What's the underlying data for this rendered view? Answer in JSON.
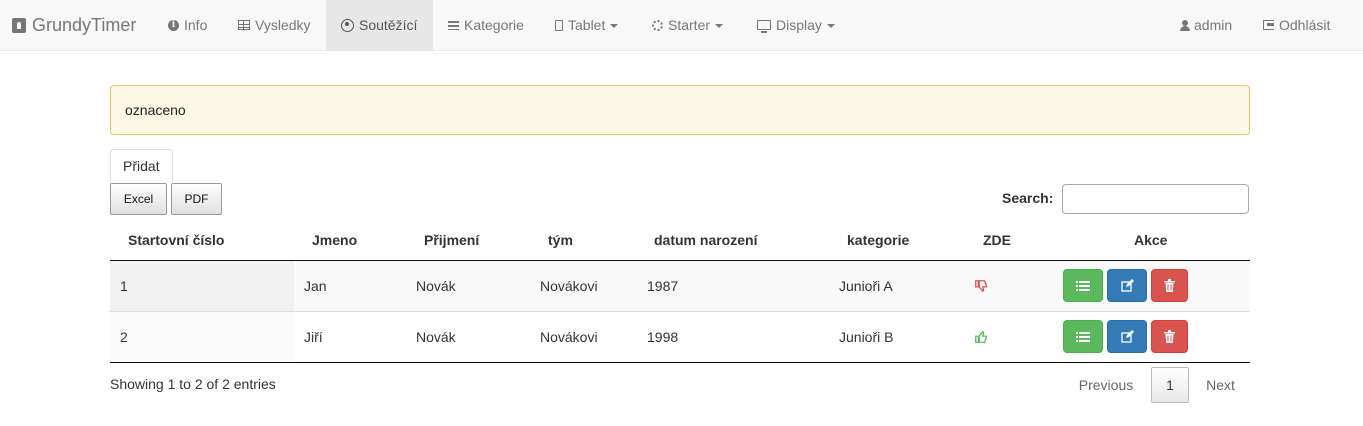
{
  "navbar": {
    "brand": "GrundyTimer",
    "items": [
      {
        "label": "Info",
        "icon": "info-circle-icon"
      },
      {
        "label": "Vysledky",
        "icon": "table-icon"
      },
      {
        "label": "Soutěžící",
        "icon": "user-circle-icon",
        "active": true
      },
      {
        "label": "Kategorie",
        "icon": "list-icon"
      },
      {
        "label": "Tablet",
        "icon": "tablet-icon",
        "dropdown": true
      },
      {
        "label": "Starter",
        "icon": "sun-icon",
        "dropdown": true
      },
      {
        "label": "Display",
        "icon": "monitor-icon",
        "dropdown": true
      }
    ],
    "user": "admin",
    "logout": "Odhlásit"
  },
  "alert": {
    "text": "oznaceno"
  },
  "toolbar": {
    "add_label": "Přidat",
    "excel_label": "Excel",
    "pdf_label": "PDF"
  },
  "search": {
    "label": "Search:",
    "value": "",
    "placeholder": ""
  },
  "table": {
    "columns": [
      "Startovní číslo",
      "Jmeno",
      "Přijmení",
      "tým",
      "datum narození",
      "kategorie",
      "ZDE",
      "Akce"
    ],
    "rows": [
      {
        "start_no": "1",
        "jmeno": "Jan",
        "prijmeni": "Novák",
        "tym": "Novákovi",
        "datum": "1987",
        "kategorie": "Junioři A",
        "zde": "thumbs-down"
      },
      {
        "start_no": "2",
        "jmeno": "Jiří",
        "prijmeni": "Novák",
        "tym": "Novákovi",
        "datum": "1998",
        "kategorie": "Junioři B",
        "zde": "thumbs-up"
      }
    ]
  },
  "footer": {
    "info": "Showing 1 to 2 of 2 entries",
    "previous": "Previous",
    "current_page": "1",
    "next": "Next"
  },
  "colors": {
    "navbar_bg": "#f8f8f8",
    "alert_bg": "#fcf8e3",
    "btn_list": "#5cb85c",
    "btn_edit": "#337ab7",
    "btn_delete": "#d9534f",
    "thumb_down": "#d9534f",
    "thumb_up": "#5cb85c"
  }
}
